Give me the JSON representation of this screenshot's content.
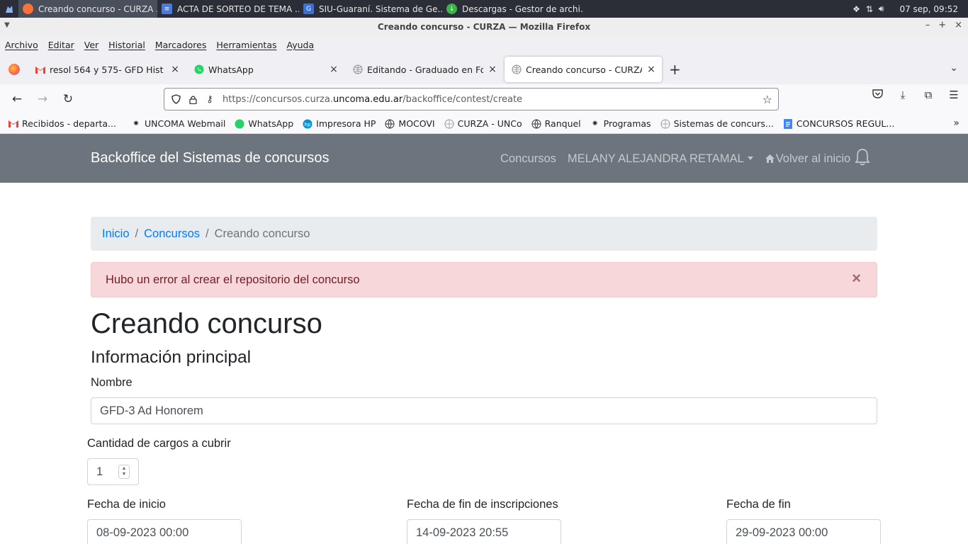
{
  "taskbar": {
    "tasks": [
      {
        "label": "Creando concurso - CURZA ..."
      },
      {
        "label": "ACTA DE SORTEO DE TEMA ..."
      },
      {
        "label": "SIU-Guaraní. Sistema de Ge..."
      },
      {
        "label": "Descargas - Gestor de archi..."
      }
    ],
    "clock": "07 sep, 09:52"
  },
  "window": {
    "title": "Creando concurso - CURZA — Mozilla Firefox"
  },
  "menubar": [
    "Archivo",
    "Editar",
    "Ver",
    "Historial",
    "Marcadores",
    "Herramientas",
    "Ayuda"
  ],
  "tabs": [
    {
      "title": "resol 564 y 575- GFD Hist de V"
    },
    {
      "title": "WhatsApp"
    },
    {
      "title": "Editando - Graduado en Form"
    },
    {
      "title": "Creando concurso - CURZA"
    }
  ],
  "url": {
    "prefix": "https://concursos.curza.",
    "domain": "uncoma.edu.ar",
    "path": "/backoffice/contest/create"
  },
  "bookmarks": [
    {
      "label": "Recibidos - departa..."
    },
    {
      "label": "UNCOMA Webmail"
    },
    {
      "label": "WhatsApp"
    },
    {
      "label": "Impresora HP"
    },
    {
      "label": "MOCOVI"
    },
    {
      "label": "CURZA - UNCo"
    },
    {
      "label": "Ranquel"
    },
    {
      "label": "Programas"
    },
    {
      "label": "Sistemas de concurs..."
    },
    {
      "label": "CONCURSOS REGUL..."
    }
  ],
  "app": {
    "brand": "Backoffice del Sistemas de concursos",
    "nav": {
      "contests": "Concursos",
      "user": "MELANY ALEJANDRA RETAMAL",
      "home": "Volver al inicio"
    }
  },
  "breadcrumb": {
    "home": "Inicio",
    "contests": "Concursos",
    "current": "Creando concurso"
  },
  "alert": {
    "message": "Hubo un error al crear el repositorio del concurso",
    "close": "×"
  },
  "form": {
    "title": "Creando concurso",
    "section": "Información principal",
    "name_label": "Nombre",
    "name_value": "GFD-3 Ad Honorem",
    "positions_label": "Cantidad de cargos a cubrir",
    "positions_value": "1",
    "start_label": "Fecha de inicio",
    "start_value": "08-09-2023 00:00",
    "reg_end_label": "Fecha de fin de inscripciones",
    "reg_end_value": "14-09-2023 20:55",
    "end_label": "Fecha de fin",
    "end_value": "29-09-2023 00:00"
  }
}
